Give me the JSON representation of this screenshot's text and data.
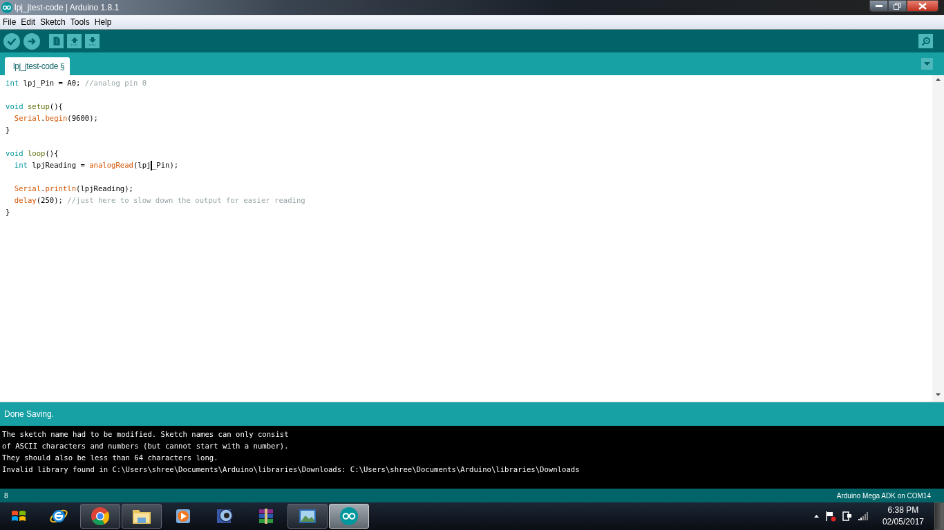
{
  "window": {
    "title": "lpj_jtest-code | Arduino 1.8.1"
  },
  "menu": [
    "File",
    "Edit",
    "Sketch",
    "Tools",
    "Help"
  ],
  "toolbar": [
    {
      "kind": "verify"
    },
    {
      "kind": "upload"
    },
    {
      "kind": "new"
    },
    {
      "kind": "open"
    },
    {
      "kind": "save"
    }
  ],
  "tabs": [
    {
      "label": "lpj_jtest-code §",
      "selected": true
    }
  ],
  "code": [
    {
      "kind": "line",
      "indented": false,
      "tokens": [
        {
          "kind": "type",
          "text": "int"
        },
        {
          "kind": "plain",
          "text": " lpj_Pin = A0; "
        },
        {
          "kind": "comment",
          "text": "//analog pin 0"
        }
      ]
    },
    {
      "kind": "blank"
    },
    {
      "kind": "line",
      "indented": false,
      "tokens": [
        {
          "kind": "type",
          "text": "void "
        },
        {
          "kind": "structure",
          "text": "setup"
        },
        {
          "kind": "plain",
          "text": "(){"
        }
      ]
    },
    {
      "kind": "line",
      "indented": true,
      "tokens": [
        {
          "kind": "function",
          "text": "Serial"
        },
        {
          "kind": "plain",
          "text": "."
        },
        {
          "kind": "function",
          "text": "begin"
        },
        {
          "kind": "plain",
          "text": "(9600);"
        }
      ]
    },
    {
      "kind": "line",
      "indented": false,
      "tokens": [
        {
          "kind": "plain",
          "text": "}"
        }
      ]
    },
    {
      "kind": "blank"
    },
    {
      "kind": "line",
      "indented": false,
      "tokens": [
        {
          "kind": "type",
          "text": "void "
        },
        {
          "kind": "structure",
          "text": "loop"
        },
        {
          "kind": "plain",
          "text": "(){"
        }
      ]
    },
    {
      "kind": "line",
      "indented": true,
      "tokens": [
        {
          "kind": "type",
          "text": "int"
        },
        {
          "kind": "plain",
          "text": " lpjReading = "
        },
        {
          "kind": "function",
          "text": "analogRead"
        },
        {
          "kind": "plain",
          "text": "(lpj",
          "caret": true
        },
        {
          "kind": "plain",
          "text": "_Pin);"
        }
      ]
    },
    {
      "kind": "blank"
    },
    {
      "kind": "line",
      "indented": true,
      "tokens": [
        {
          "kind": "function",
          "text": "Serial"
        },
        {
          "kind": "plain",
          "text": "."
        },
        {
          "kind": "function",
          "text": "println"
        },
        {
          "kind": "plain",
          "text": "(lpjReading);"
        }
      ]
    },
    {
      "kind": "line",
      "indented": true,
      "tokens": [
        {
          "kind": "function",
          "text": "delay"
        },
        {
          "kind": "plain",
          "text": "(250); "
        },
        {
          "kind": "comment",
          "text": "//just here to slow down the output for easier reading"
        }
      ]
    },
    {
      "kind": "line",
      "indented": false,
      "tokens": [
        {
          "kind": "plain",
          "text": "}"
        }
      ]
    }
  ],
  "status": "Done Saving.",
  "console": [
    "The sketch name had to be modified. Sketch names can only consist",
    "of ASCII characters and numbers (but cannot start with a number).",
    "They should also be less than 64 characters long.",
    "Invalid library found in C:\\Users\\shree\\Documents\\Arduino\\libraries\\Downloads: C:\\Users\\shree\\Documents\\Arduino\\libraries\\Downloads"
  ],
  "footer": {
    "line": "8",
    "board": "Arduino Mega ADK on COM14"
  },
  "taskbar": {
    "apps": [
      {
        "kind": "ie",
        "running": false,
        "selected": false
      },
      {
        "kind": "chrome",
        "running": true,
        "selected": false
      },
      {
        "kind": "folder",
        "running": true,
        "selected": false
      },
      {
        "kind": "media",
        "running": false,
        "selected": false
      },
      {
        "kind": "viewer",
        "running": false,
        "selected": false
      },
      {
        "kind": "archive",
        "running": false,
        "selected": false
      },
      {
        "kind": "photos",
        "running": true,
        "selected": false
      },
      {
        "kind": "arduino",
        "running": true,
        "selected": true
      }
    ],
    "time": "6:38 PM",
    "date": "02/05/2017"
  }
}
